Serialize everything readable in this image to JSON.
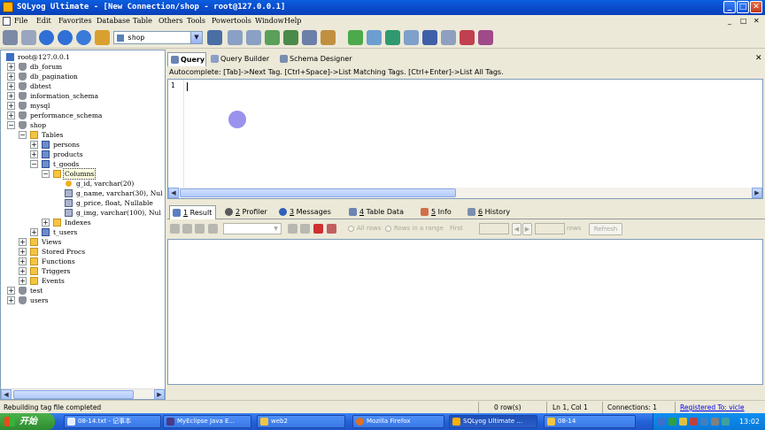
{
  "window": {
    "title": "SQLyog Ultimate - [New Connection/shop - root@127.0.0.1]",
    "controls": [
      "_",
      "□",
      "✕"
    ]
  },
  "menu": {
    "items": [
      "File",
      "Edit",
      "Favorites",
      "Database",
      "Table",
      "Others",
      "Tools",
      "Powertools",
      "Window",
      "Help"
    ],
    "doc_controls": [
      "_",
      "□",
      "✕"
    ]
  },
  "toolbar": {
    "database_select": "shop"
  },
  "tree": {
    "root": "root@127.0.0.1",
    "databases": [
      "db_forum",
      "db_pagination",
      "dbtest",
      "information_schema",
      "mysql",
      "performance_schema",
      "shop",
      "test",
      "users"
    ],
    "shop_children": {
      "tables_label": "Tables",
      "tables": [
        "persons",
        "products",
        "t_goods",
        "t_users"
      ],
      "columns_label": "Columns",
      "columns": [
        "g_id, varchar(20)",
        "g_name, varchar(30), Nul",
        "g_price, float, Nullable",
        "g_img, varchar(100), Nul"
      ],
      "indexes_label": "Indexes",
      "other_folders": [
        "Views",
        "Stored Procs",
        "Functions",
        "Triggers",
        "Events"
      ]
    }
  },
  "query_tabs": {
    "tabs": [
      "Query",
      "Query Builder",
      "Schema Designer"
    ],
    "active": "Query"
  },
  "autocomplete_hint": "Autocomplete: [Tab]->Next Tag. [Ctrl+Space]->List Matching Tags. [Ctrl+Enter]->List All Tags.",
  "editor": {
    "line_number": "1",
    "content": ""
  },
  "result_tabs": {
    "tabs": [
      {
        "key": "1",
        "label": "Result"
      },
      {
        "key": "2",
        "label": "Profiler"
      },
      {
        "key": "3",
        "label": "Messages"
      },
      {
        "key": "4",
        "label": "Table Data"
      },
      {
        "key": "5",
        "label": "Info"
      },
      {
        "key": "6",
        "label": "History"
      }
    ],
    "active": "Result"
  },
  "result_toolbar": {
    "all_rows": "All rows",
    "rows_in_range": "Rows in a range",
    "first": "First",
    "rows": "rows",
    "refresh": "Refresh"
  },
  "status": {
    "message": "Rebuilding tag file completed",
    "rows": "0 row(s)",
    "position": "Ln 1, Col 1",
    "connections": "Connections: 1",
    "registered": "Registered To: vicle"
  },
  "taskbar": {
    "start": "开始",
    "tasks": [
      "08-14.txt - 记事本",
      "MyEclipse Java E...",
      "web2",
      "Mozilla Firefox",
      "SQLyog Ultimate ...",
      "08-14"
    ],
    "active": "SQLyog Ultimate ...",
    "clock": "13:02"
  },
  "colors": {
    "titlebar": "#0a4fd0",
    "chrome": "#ece9d8",
    "taskbar": "#2462d8",
    "start": "#2f8c2f",
    "link": "#0000ee"
  }
}
